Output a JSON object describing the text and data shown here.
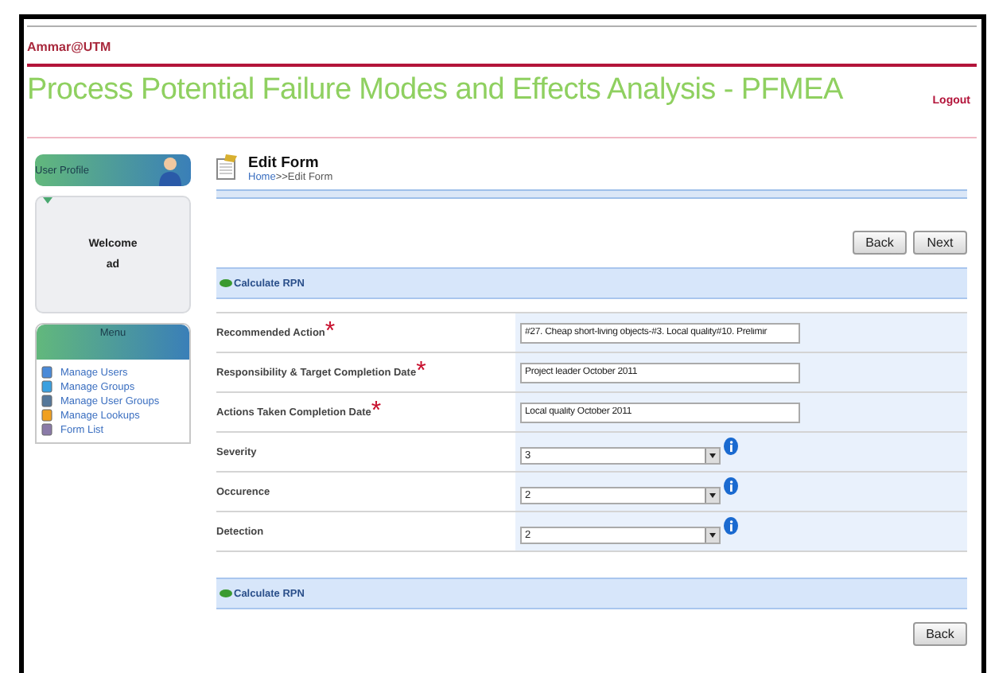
{
  "header": {
    "user": "Ammar@UTM",
    "title": "Process Potential Failure Modes and Effects Analysis - PFMEA",
    "logout": "Logout"
  },
  "sidebar": {
    "profile_title": "User Profile",
    "welcome": "Welcome",
    "username": "ad",
    "menu_title": "Menu",
    "menu_items": [
      {
        "label": "Manage Users"
      },
      {
        "label": "Manage Groups"
      },
      {
        "label": "Manage User Groups"
      },
      {
        "label": "Manage Lookups"
      },
      {
        "label": "Form List"
      }
    ]
  },
  "page": {
    "title": "Edit Form",
    "breadcrumb_link": "Home",
    "breadcrumb_rest": ">>Edit Form"
  },
  "top_buttons": [
    "Back",
    "Next"
  ],
  "section_title": "Calculate RPN",
  "fields": [
    {
      "kind": "text",
      "label": "Recommended Action",
      "required_mark": "*",
      "value": "#27. Cheap short-living objects-#3. Local quality#10. Prelimir"
    },
    {
      "kind": "text",
      "label": "Responsibility & Target Completion Date",
      "required_mark": "*",
      "value": "Project leader October 2011"
    },
    {
      "kind": "text",
      "label": "Actions Taken Completion Date",
      "required_mark": "*",
      "value": "Local quality October 2011"
    },
    {
      "kind": "select",
      "label": "Severity",
      "value": "3"
    },
    {
      "kind": "select",
      "label": "Occurence",
      "value": "2"
    },
    {
      "kind": "select",
      "label": "Detection",
      "value": "2"
    }
  ],
  "bottom_section_title": "Calculate RPN",
  "bottom_buttons": [
    "Back"
  ]
}
